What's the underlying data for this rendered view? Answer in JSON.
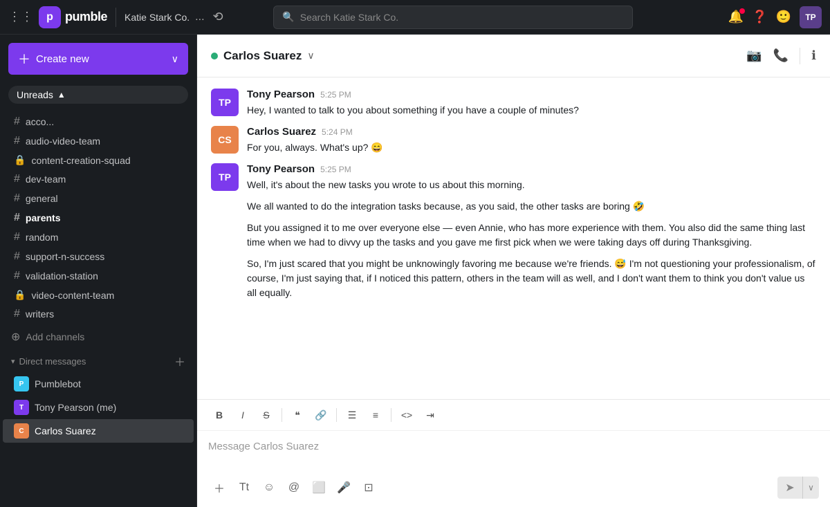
{
  "app": {
    "name": "pumble",
    "workspace": "Katie Stark Co.",
    "more_label": "...",
    "search_placeholder": "Search Katie Stark Co."
  },
  "sidebar": {
    "create_new_label": "Create new",
    "unreads_label": "Unreads",
    "channels": [
      {
        "name": "acco...",
        "type": "hash"
      },
      {
        "name": "audio-video-team",
        "type": "hash"
      },
      {
        "name": "content-creation-squad",
        "type": "lock"
      },
      {
        "name": "dev-team",
        "type": "hash"
      },
      {
        "name": "general",
        "type": "hash"
      },
      {
        "name": "parents",
        "type": "hash",
        "bold": true
      },
      {
        "name": "random",
        "type": "hash"
      },
      {
        "name": "support-n-success",
        "type": "hash"
      },
      {
        "name": "validation-station",
        "type": "hash"
      },
      {
        "name": "video-content-team",
        "type": "lock"
      },
      {
        "name": "writers",
        "type": "hash"
      }
    ],
    "add_channels_label": "Add channels",
    "direct_messages_label": "Direct messages",
    "dms": [
      {
        "name": "Pumblebot",
        "type": "bot"
      },
      {
        "name": "Tony Pearson (me)",
        "type": "tony"
      },
      {
        "name": "Carlos Suarez",
        "type": "carlos",
        "active": true
      }
    ]
  },
  "chat": {
    "contact_name": "Carlos Suarez",
    "messages": [
      {
        "sender": "Tony Pearson",
        "avatar_type": "tony",
        "time": "5:25 PM",
        "text": "Hey, I wanted to talk to you about something if you have a couple of minutes?"
      },
      {
        "sender": "Carlos Suarez",
        "avatar_type": "carlos",
        "time": "5:24 PM",
        "text": "For you, always. What's up? 😄"
      },
      {
        "sender": "Tony Pearson",
        "avatar_type": "tony",
        "time": "5:25 PM",
        "paragraphs": [
          "Well, it's about the new tasks you wrote to us about this morning.",
          "We all wanted to do the integration tasks because, as you said, the other tasks are boring 🤣",
          "But you assigned it to me over everyone else — even Annie, who has more experience with them. You also did the same thing last time when we had to divvy up the tasks and you gave me first pick when we were taking days off during Thanksgiving.",
          "So, I'm just scared that you might be unknowingly favoring me because we're friends. 😅 I'm not questioning your professionalism, of course, I'm just saying that, if I noticed this pattern, others in the team will as well, and I don't want them to think you don't value us all equally."
        ]
      }
    ],
    "input_placeholder": "Message Carlos Suarez",
    "format_buttons": [
      "B",
      "I",
      "S",
      "❝",
      "🔗",
      "☰",
      "≡",
      "<>",
      "⇥"
    ],
    "bottom_buttons": [
      "+",
      "Tt",
      "☺",
      "@",
      "📷",
      "🎤",
      "⊡"
    ]
  }
}
